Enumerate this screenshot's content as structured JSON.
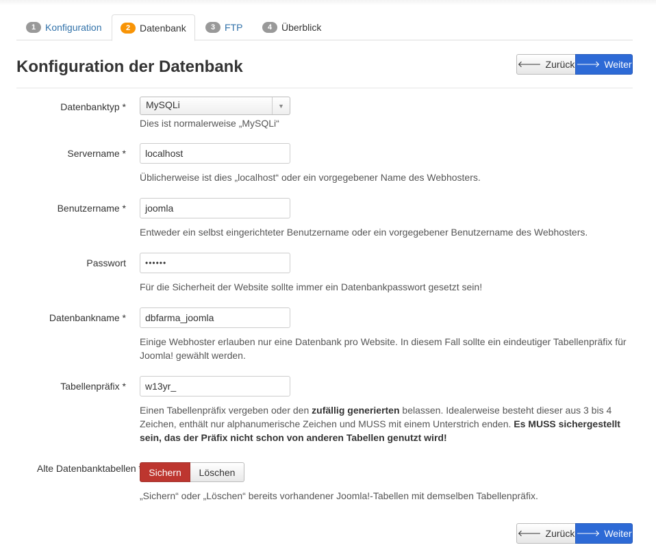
{
  "tabs": [
    {
      "num": "1",
      "label": "Konfiguration"
    },
    {
      "num": "2",
      "label": "Datenbank"
    },
    {
      "num": "3",
      "label": "FTP"
    },
    {
      "num": "4",
      "label": "Überblick"
    }
  ],
  "header": {
    "title": "Konfiguration der Datenbank",
    "back_label": "Zurück",
    "next_label": "Weiter"
  },
  "form": {
    "db_type": {
      "label": "Datenbanktyp *",
      "value": "MySQLi",
      "help": "Dies ist normalerweise „MySQLi“"
    },
    "server": {
      "label": "Servername *",
      "value": "localhost",
      "help": "Üblicherweise ist dies „localhost“ oder ein vorgegebener Name des Webhosters."
    },
    "user": {
      "label": "Benutzername *",
      "value": "joomla",
      "help": "Entweder ein selbst eingerichteter Benutzername oder ein vorgegebener Benutzername des Webhosters."
    },
    "password": {
      "label": "Passwort",
      "value": "••••••",
      "help": "Für die Sicherheit der Website sollte immer ein Datenbankpasswort gesetzt sein!"
    },
    "db_name": {
      "label": "Datenbankname *",
      "value": "dbfarma_joomla",
      "help_line1": "Einige Webhoster erlauben nur eine Datenbank pro Website. In diesem Fall sollte ein eindeutiger Tabellenpräfix für",
      "help_line2": "Joomla! gewählt werden."
    },
    "prefix": {
      "label": "Tabellenpräfix *",
      "value": "w13yr_",
      "help_a": "Einen Tabellenpräfix vergeben oder den ",
      "help_bold1": "zufällig generierten",
      "help_b": " belassen. Idealerweise besteht dieser aus 3 bis 4 Zeichen, enthält nur alphanumerische Zeichen und MUSS mit einem Unterstrich enden. ",
      "help_bold2": "Es MUSS sichergestellt sein, das der Präfix nicht schon von anderen Tabellen genutzt wird!"
    },
    "old_tables": {
      "label": "Alte Datenbanktabellen *",
      "option_backup": "Sichern",
      "option_delete": "Löschen",
      "help": "„Sichern“ oder „Löschen“ bereits vorhandener Joomla!-Tabellen mit demselben Tabellenpräfix."
    }
  },
  "footer": {
    "back_label": "Zurück",
    "next_label": "Weiter"
  },
  "colors": {
    "primary": "#2d6ad6",
    "danger": "#bd362f",
    "active_step": "#f89406",
    "inactive_step": "#999999",
    "link": "#3071a9"
  }
}
